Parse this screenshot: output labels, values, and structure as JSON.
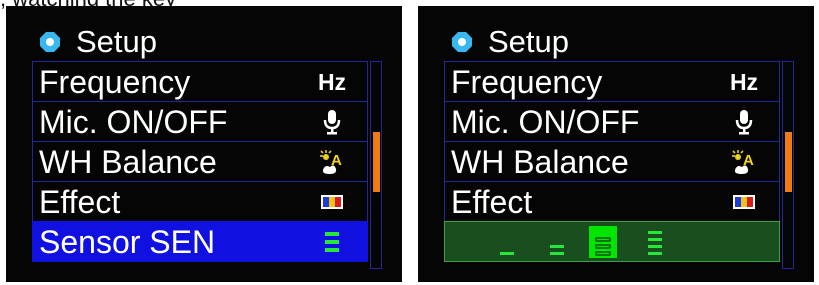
{
  "crop_caption": ", watching the key",
  "colors": {
    "background": "#050505",
    "row_border": "#24279a",
    "selected_blue": "#1010e0",
    "selected_green": "#194f1f",
    "scroll_thumb": "#f07a14",
    "level_green": "#00e600"
  },
  "screens": [
    {
      "title": "Setup",
      "title_icon": "setup-crosshair-icon",
      "items": [
        {
          "label": "Frequency",
          "value_text": "Hz",
          "icon": "hz-icon"
        },
        {
          "label": "Mic. ON/OFF",
          "icon": "microphone-icon"
        },
        {
          "label": "WH Balance",
          "icon": "white-balance-icon"
        },
        {
          "label": "Effect",
          "icon": "color-effect-icon"
        },
        {
          "label": "Sensor SEN",
          "icon": "sensor-level-icon",
          "selected": true
        }
      ],
      "scroll_position": 0.6
    },
    {
      "title": "Setup",
      "title_icon": "setup-crosshair-icon",
      "items": [
        {
          "label": "Frequency",
          "value_text": "Hz",
          "icon": "hz-icon"
        },
        {
          "label": "Mic. ON/OFF",
          "icon": "microphone-icon"
        },
        {
          "label": "WH Balance",
          "icon": "white-balance-icon"
        },
        {
          "label": "Effect",
          "icon": "color-effect-icon"
        }
      ],
      "sensitivity_selector": {
        "levels": 4,
        "selected_level": 3
      },
      "scroll_position": 0.6
    }
  ]
}
